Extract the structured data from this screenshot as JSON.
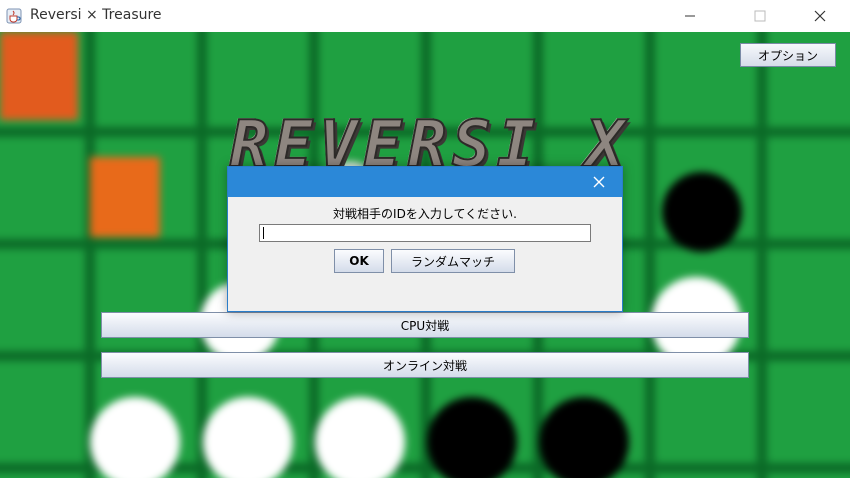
{
  "window": {
    "title": "Reversi × Treasure",
    "icons": {
      "app": "java-cup-icon",
      "minimize": "minimize-icon",
      "maximize": "maximize-icon",
      "close": "close-icon"
    }
  },
  "game": {
    "options_label": "オプション",
    "logo_text": "REVERSI X TREASURE",
    "cpu_match_label": "CPU対戦",
    "online_match_label": "オンライン対戦",
    "colors": {
      "board_green": "#1fa041",
      "grid_line": "#0a6b26",
      "dialog_title": "#2b88d8"
    }
  },
  "dialog": {
    "message": "対戦相手のIDを入力してください.",
    "input_value": "",
    "ok_label": "OK",
    "random_match_label": "ランダムマッチ"
  }
}
